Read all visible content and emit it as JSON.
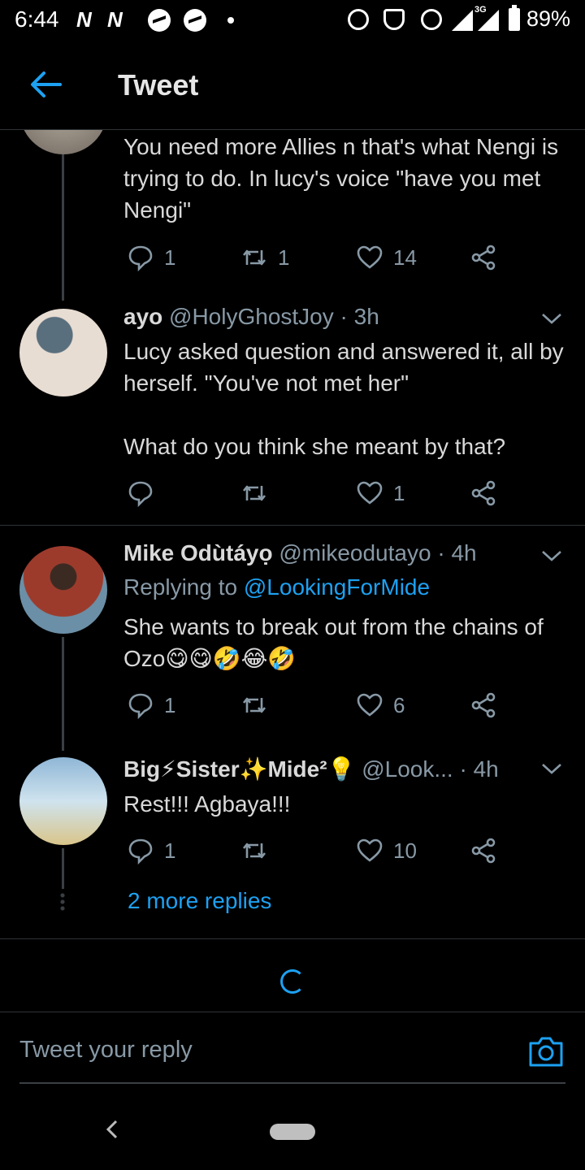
{
  "status_bar": {
    "time": "6:44",
    "n_icons": "N N",
    "network": "3G",
    "battery": "89%"
  },
  "header": {
    "title": "Tweet",
    "icon": "back-arrow-icon"
  },
  "tweets": [
    {
      "text": "You need more Allies n that's what Nengi is trying to do. In lucy's voice \"have you met Nengi\"",
      "replies": "1",
      "retweets": "1",
      "likes": "14"
    },
    {
      "name": "ayo",
      "handle": "@HolyGhostJoy",
      "time": "· 3h",
      "text": "Lucy asked question and answered it, all by herself. \"You've not met her\"\n\nWhat do you think she meant by that?",
      "replies": "",
      "retweets": "",
      "likes": "1"
    },
    {
      "name": "Mike Odùtáyọ",
      "handle": "@mikeodutayo",
      "time": "· 4h",
      "replying_prefix": "Replying to",
      "replying_handle": "@LookingForMide",
      "text": "She wants to break out from the chains of Ozo😋😋🤣😂🤣",
      "replies": "1",
      "retweets": "",
      "likes": "6"
    },
    {
      "name": "Big⚡Sister✨Mide²💡",
      "handle": "@Look...",
      "time": "· 4h",
      "text": "Rest!!! Agbaya!!!",
      "replies": "1",
      "retweets": "",
      "likes": "10"
    }
  ],
  "more_replies": "2 more replies",
  "reply_placeholder": "Tweet your reply",
  "colors": {
    "accent": "#1da1f2",
    "background": "#000000",
    "muted": "#8899a6"
  }
}
